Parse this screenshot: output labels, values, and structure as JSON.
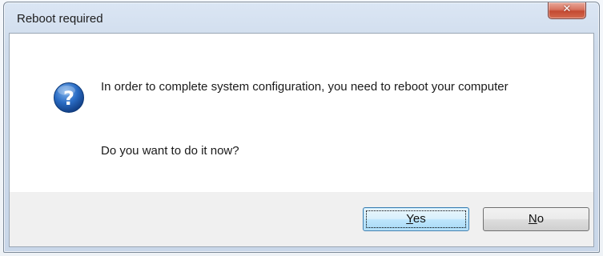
{
  "window": {
    "title": "Reboot required"
  },
  "message": {
    "line1": "In order to complete system configuration, you need to reboot your computer",
    "line2": "Do you want to do it now?"
  },
  "buttons": {
    "yes": {
      "mnemonic": "Y",
      "rest": "es"
    },
    "no": {
      "mnemonic": "N",
      "rest": "o"
    }
  },
  "icons": {
    "message_icon": "question-icon",
    "close": "close-icon"
  },
  "colors": {
    "icon_blue": "#1f5fb3",
    "close_red": "#c44a32",
    "default_button_border": "#3c7fb1"
  }
}
